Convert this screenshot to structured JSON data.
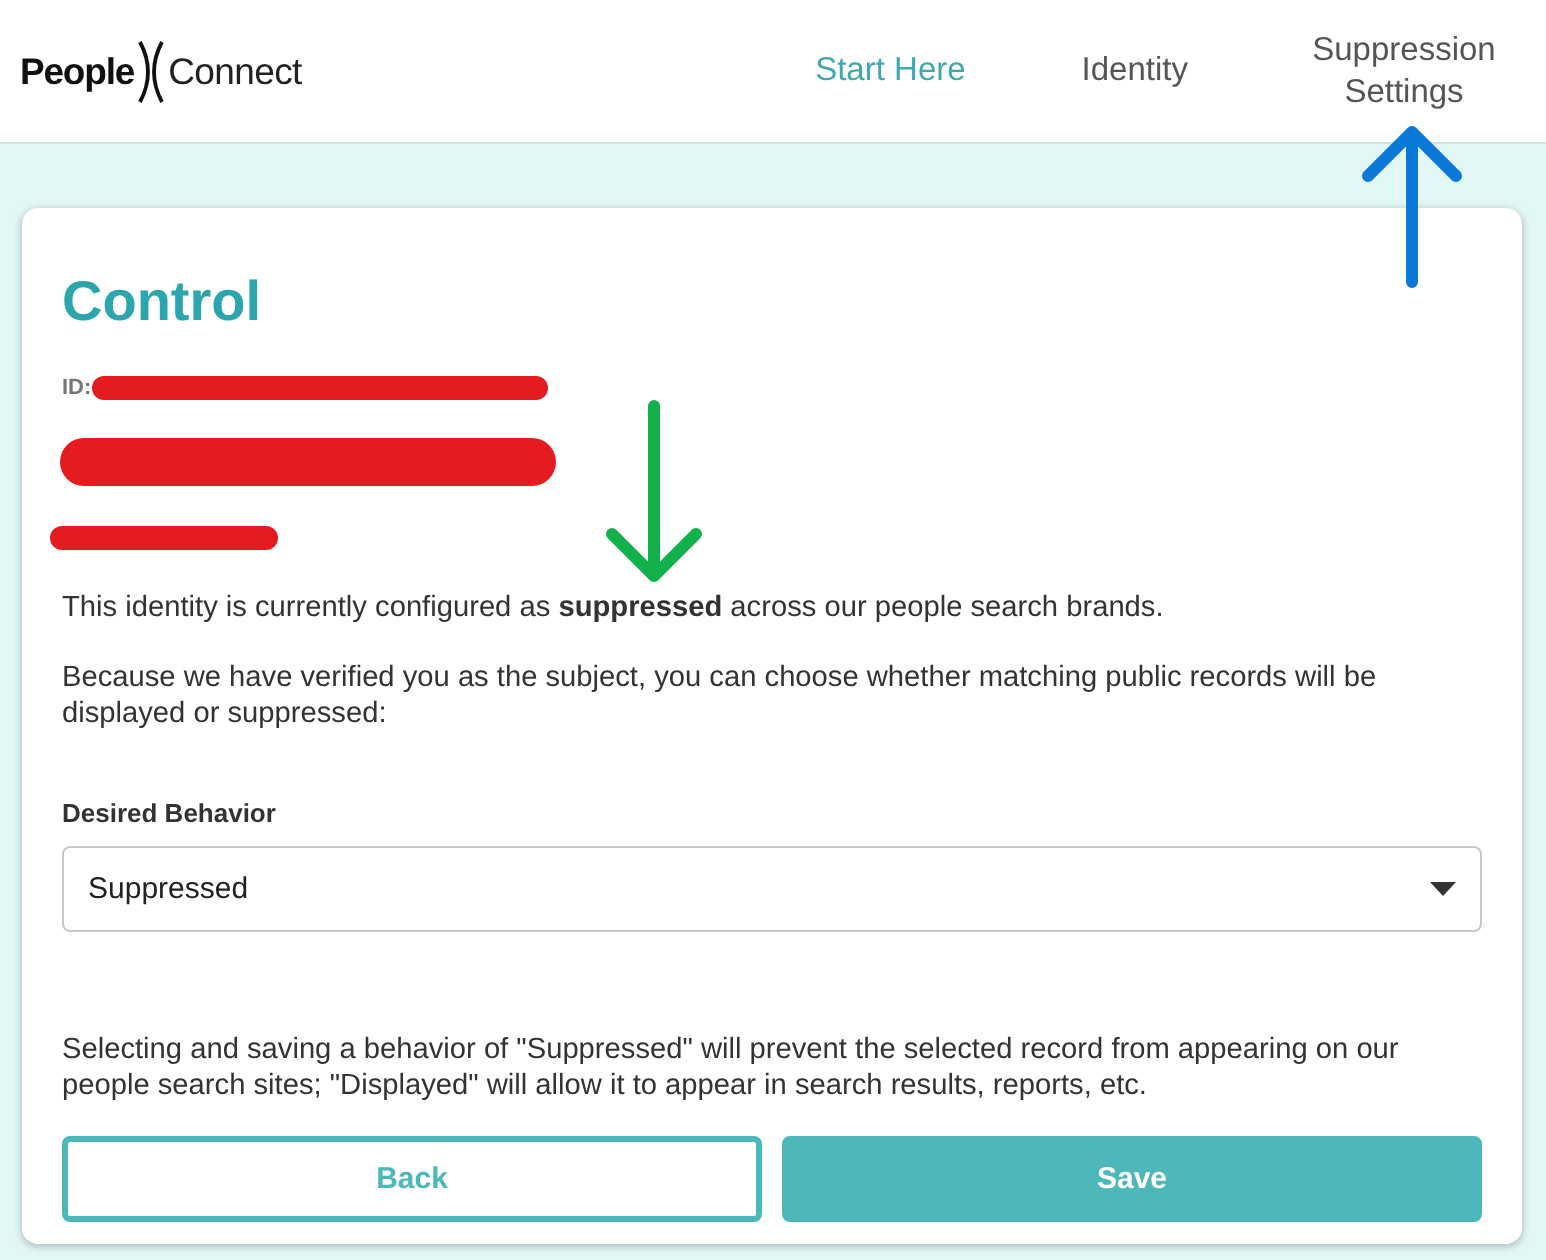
{
  "header": {
    "logo": {
      "word_1": "People",
      "word_2": "Connect"
    },
    "nav": [
      {
        "label": "Start Here",
        "selected": true
      },
      {
        "label": "Identity",
        "selected": false
      },
      {
        "label": "Suppression Settings",
        "selected": false
      }
    ]
  },
  "card": {
    "title": "Control",
    "id_label": "ID:",
    "status_text": "This identity is currently configured as **suppressed** across our people search brands.",
    "intro_text": "Because we have verified you as the subject, you can choose whether matching public records will be displayed or suppressed:",
    "field": {
      "label": "Desired Behavior",
      "value": "Suppressed"
    },
    "help_text": "Selecting and saving a behavior of \"Suppressed\" will prevent the selected record from appearing on our people search sites; \"Displayed\" will allow it to appear in search results, reports, etc.",
    "buttons": [
      {
        "label": "Back",
        "kind": "outline"
      },
      {
        "label": "Save",
        "kind": "primary"
      }
    ]
  }
}
